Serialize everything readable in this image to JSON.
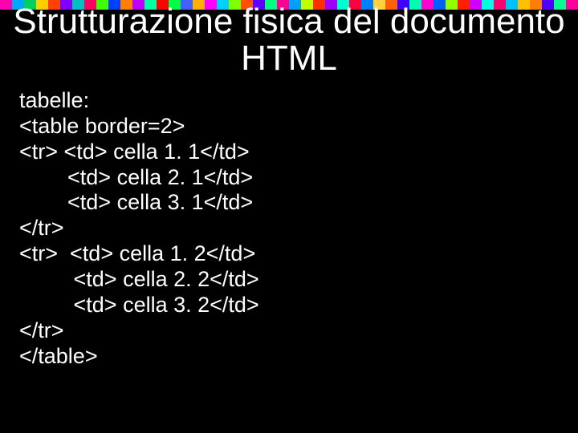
{
  "strip_colors": [
    "#ff00b0",
    "#00a8ff",
    "#00d060",
    "#ffd000",
    "#ff4000",
    "#8000ff",
    "#00c0c0",
    "#ff0060",
    "#40ff00",
    "#0040ff",
    "#ff8000",
    "#c000ff",
    "#00ffa0",
    "#ff0000",
    "#00ff40",
    "#4060ff",
    "#ffb000",
    "#ff00ff",
    "#00d0ff",
    "#80ff00",
    "#ff5000",
    "#6000ff",
    "#00ff80",
    "#ff0090",
    "#00a0ff",
    "#c0ff00",
    "#ff3000",
    "#a000ff",
    "#00ffd0",
    "#ff0040",
    "#0080ff",
    "#ffd040",
    "#ff6000",
    "#4000ff",
    "#00ffb0",
    "#ff00d0",
    "#0060ff",
    "#90ff00",
    "#ff2000",
    "#d000ff",
    "#00ffe0",
    "#ff0070",
    "#00c0ff",
    "#ffc000",
    "#ff8000",
    "#5000ff",
    "#00ff90",
    "#ff00a0"
  ],
  "title": "Strutturazione fisica del documento HTML",
  "body": {
    "l0": "tabelle:",
    "l1": "<table border=2>",
    "l2": "<tr> <td> cella 1. 1</td>",
    "l3": "        <td> cella 2. 1</td>",
    "l4": "        <td> cella 3. 1</td>",
    "l5": "</tr>",
    "l6": "<tr>  <td> cella 1. 2</td>",
    "l7": "         <td> cella 2. 2</td>",
    "l8": "         <td> cella 3. 2</td>",
    "l9": "</tr>",
    "l10": "</table>"
  }
}
